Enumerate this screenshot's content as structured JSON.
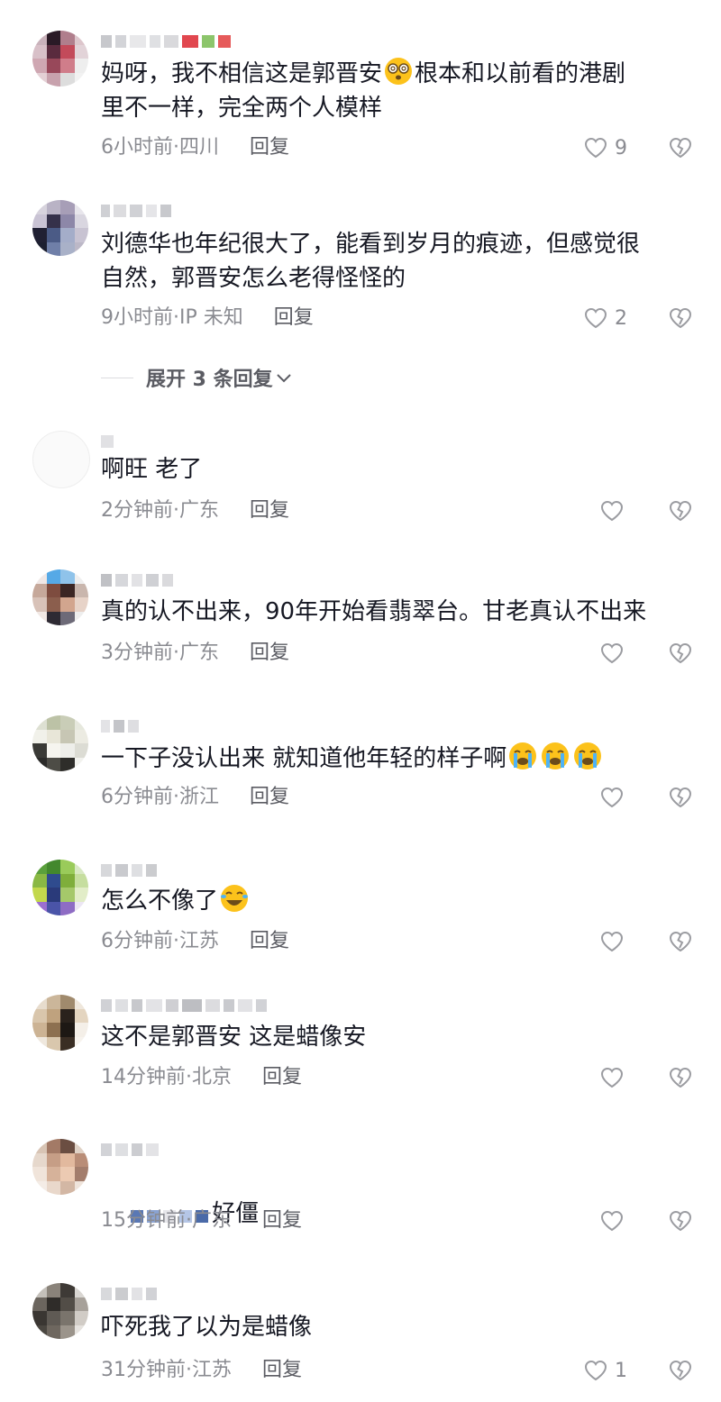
{
  "comments": [
    {
      "text": "妈呀，我不相信这是郭晋安",
      "text_after_emoji": "根本和以前看的港剧\n里不一样，完全两个人模样",
      "time": "6小时前",
      "location": "四川",
      "reply": "回复",
      "likes": "9"
    },
    {
      "text": "刘德华也年纪很大了，能看到岁月的痕迹，但感觉很\n自然，郭晋安怎么老得怪怪的",
      "time": "9小时前",
      "location": "IP 未知",
      "reply": "回复",
      "likes": "2"
    },
    {
      "text": "啊旺 老了",
      "time": "2分钟前",
      "location": "广东",
      "reply": "回复",
      "likes": ""
    },
    {
      "text": "真的认不出来，90年开始看翡翠台。甘老真认不出来",
      "time": "3分钟前",
      "location": "广东",
      "reply": "回复",
      "likes": ""
    },
    {
      "text": "一下子没认出来 就知道他年轻的样子啊",
      "time": "6分钟前",
      "location": "浙江",
      "reply": "回复",
      "likes": ""
    },
    {
      "text": "怎么不像了",
      "time": "6分钟前",
      "location": "江苏",
      "reply": "回复",
      "likes": ""
    },
    {
      "text": "这不是郭晋安 这是蜡像安",
      "time": "14分钟前",
      "location": "北京",
      "reply": "回复",
      "likes": ""
    },
    {
      "text": "好僵",
      "time": "15分钟前",
      "location": "广东",
      "reply": "回复",
      "likes": ""
    },
    {
      "text": "吓死我了以为是蜡像",
      "time": "31分钟前",
      "location": "江苏",
      "reply": "回复",
      "likes": "1"
    }
  ],
  "expand_replies": "展开 3 条回复",
  "meta_separator": " · ",
  "icons": [
    "heart-icon",
    "heart-broken-icon",
    "chevron-down-icon",
    "dizzy-face-emoji",
    "crying-face-emoji",
    "laughing-tears-emoji"
  ],
  "colors": {
    "text": "#161823",
    "meta": "#8a8b91",
    "reply": "#5b5c63",
    "icon": "#9b9ca1"
  }
}
